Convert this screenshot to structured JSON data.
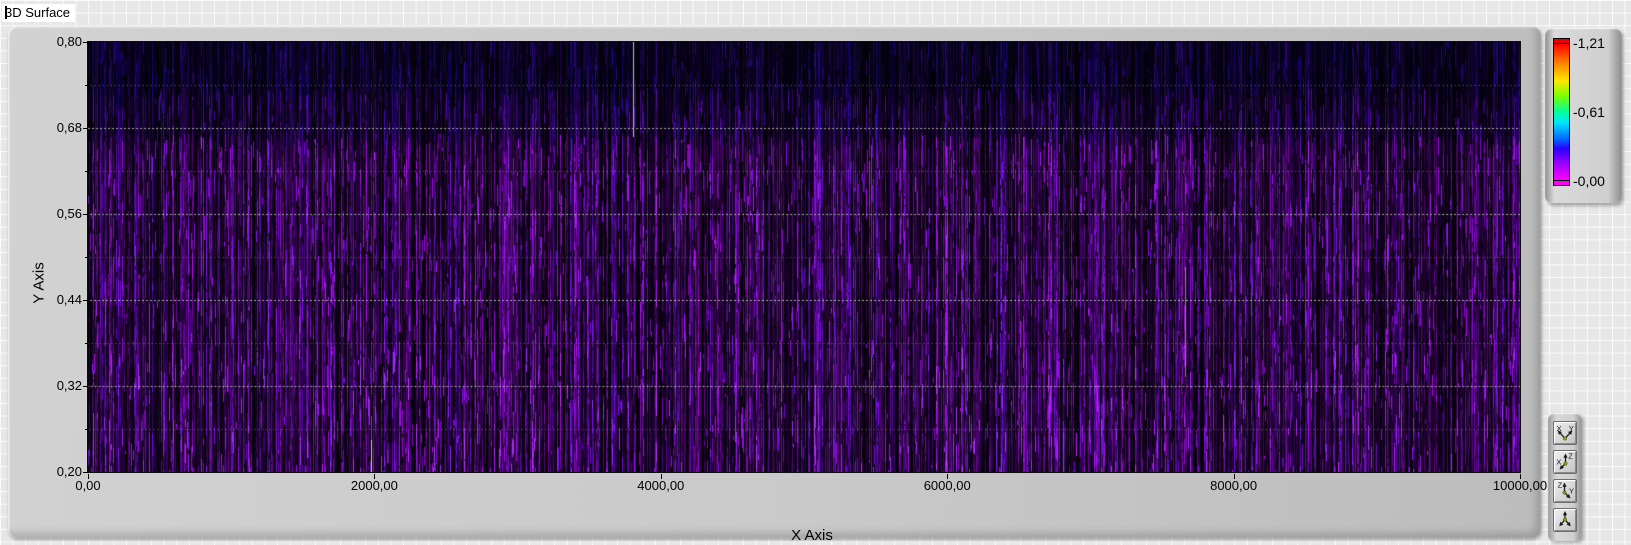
{
  "graph_label": "3D Surface",
  "chart_data": {
    "type": "heatmap",
    "title": "3D Surface",
    "xlabel": "X Axis",
    "ylabel": "Y Axis",
    "x_range": [
      0,
      10000
    ],
    "y_range": [
      0.2,
      0.8
    ],
    "x_ticks": [
      0,
      2000,
      4000,
      6000,
      8000,
      10000
    ],
    "x_tick_labels": [
      "0,00",
      "2000,00",
      "4000,00",
      "6000,00",
      "8000,00",
      "10000,00"
    ],
    "y_ticks": [
      0.8,
      0.68,
      0.56,
      0.44,
      0.32,
      0.2
    ],
    "y_tick_labels": [
      "0,80",
      "0,68",
      "0,56",
      "0,44",
      "0,32",
      "0,20"
    ],
    "grid": "dotted horizontal gridlines at major and half-major Y positions",
    "legend_position": "color scale at top right",
    "description": "Dense random noise intensity surface; values cluster near the low (magenta/purple) end of the scale, appearing as vertical violet streaks on black; upper band slightly darker and bluer."
  },
  "color_scale": {
    "labels": [
      "-1,21",
      "-0,61",
      "-0,00"
    ],
    "label_fractions": [
      0.035,
      0.5,
      0.965
    ],
    "top_cap_color": "#e80000",
    "bottom_cap_color": "#ff00ff",
    "gradient_stops": [
      {
        "color": "#ff0000",
        "pos": 0
      },
      {
        "color": "#ff8a00",
        "pos": 15
      },
      {
        "color": "#ffe600",
        "pos": 27
      },
      {
        "color": "#7dff00",
        "pos": 38
      },
      {
        "color": "#00ff9d",
        "pos": 50
      },
      {
        "color": "#00e4ff",
        "pos": 58
      },
      {
        "color": "#0066ff",
        "pos": 70
      },
      {
        "color": "#2a00ff",
        "pos": 77
      },
      {
        "color": "#8800ff",
        "pos": 86
      },
      {
        "color": "#ff00ff",
        "pos": 100
      }
    ]
  },
  "projection_buttons": [
    {
      "name": "xy-projection-button",
      "icon": "xy-axes-icon"
    },
    {
      "name": "xz-projection-button",
      "icon": "xz-axes-icon"
    },
    {
      "name": "zy-projection-button",
      "icon": "zy-axes-icon"
    },
    {
      "name": "3d-view-button",
      "icon": "3d-axes-icon"
    }
  ],
  "texture": {
    "background": "#060009",
    "hue_center": 276,
    "seed": 1337,
    "gridline_color_major": "rgba(215,228,210,0.75)",
    "gridline_color_minor": "rgba(185,198,185,0.55)"
  }
}
